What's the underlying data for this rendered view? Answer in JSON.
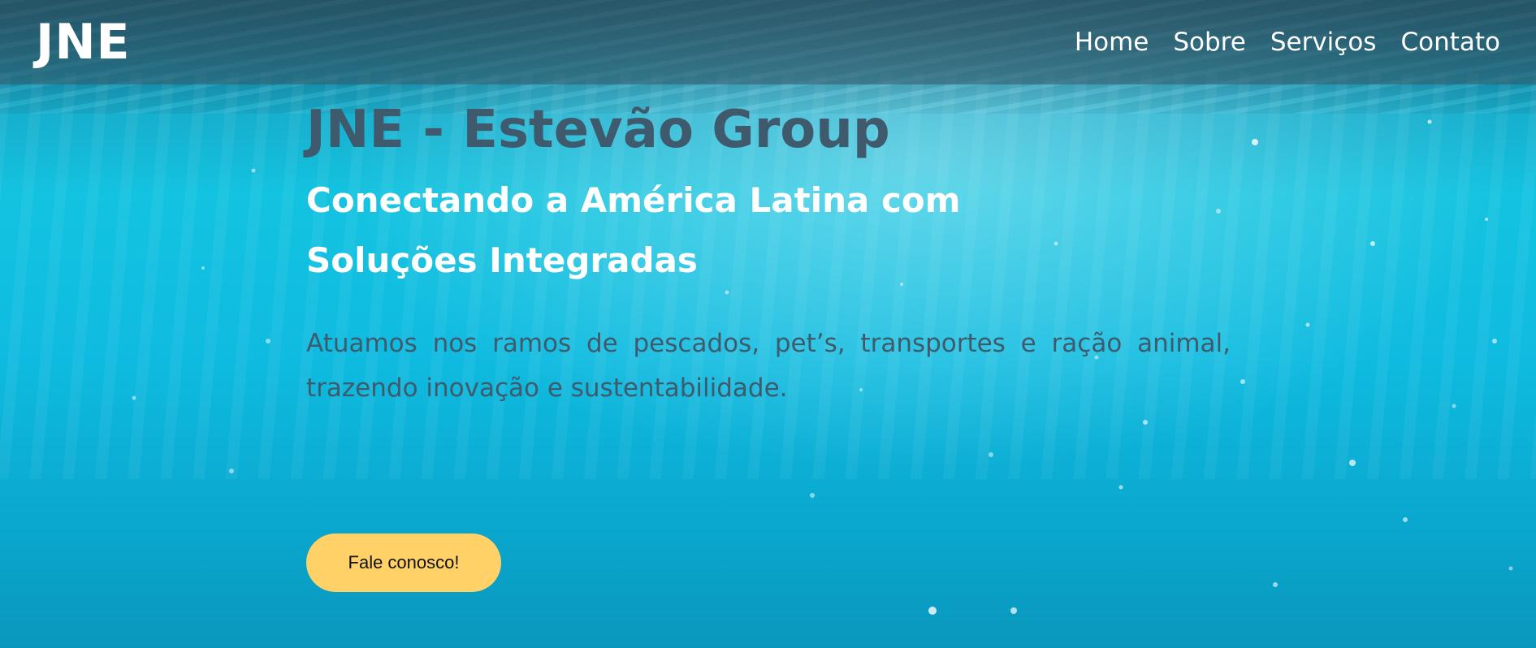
{
  "header": {
    "logo": "JNE",
    "nav": [
      "Home",
      "Sobre",
      "Serviços",
      "Contato"
    ]
  },
  "hero": {
    "title": "JNE - Estevão Group",
    "subtitle": "Conectando a América Latina com Soluções Integradas",
    "description": "Atuamos nos ramos de pescados, pet’s, transportes e ração animal, trazendo inovação e sustentabilidade.",
    "cta_label": "Fale conosco!"
  },
  "colors": {
    "title_text": "#3f5a6c",
    "cta_background": "#ffd166",
    "water": "#13c3e0"
  }
}
